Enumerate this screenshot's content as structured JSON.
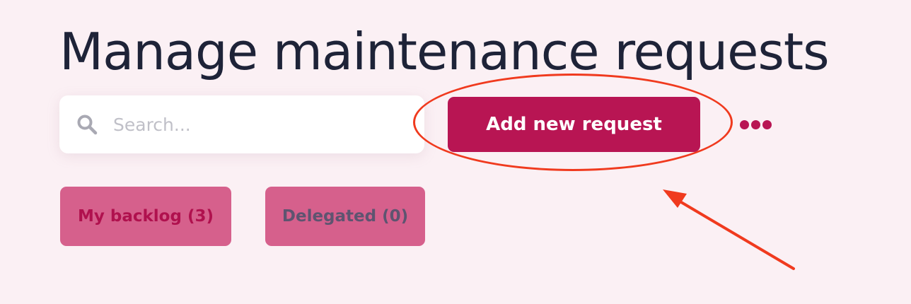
{
  "page": {
    "title": "Manage maintenance requests"
  },
  "search": {
    "icon": "search-icon",
    "placeholder": "Search..."
  },
  "toolbar": {
    "add_label": "Add new request",
    "more_icon": "more-horizontal-icon"
  },
  "filters": [
    {
      "label": "My backlog (3)",
      "active": true
    },
    {
      "label": "Delegated (0)",
      "active": false
    }
  ],
  "colors": {
    "background": "#fbf0f4",
    "accent": "#b81553",
    "chip": "#d6608c",
    "annotation": "#f03a1e"
  }
}
